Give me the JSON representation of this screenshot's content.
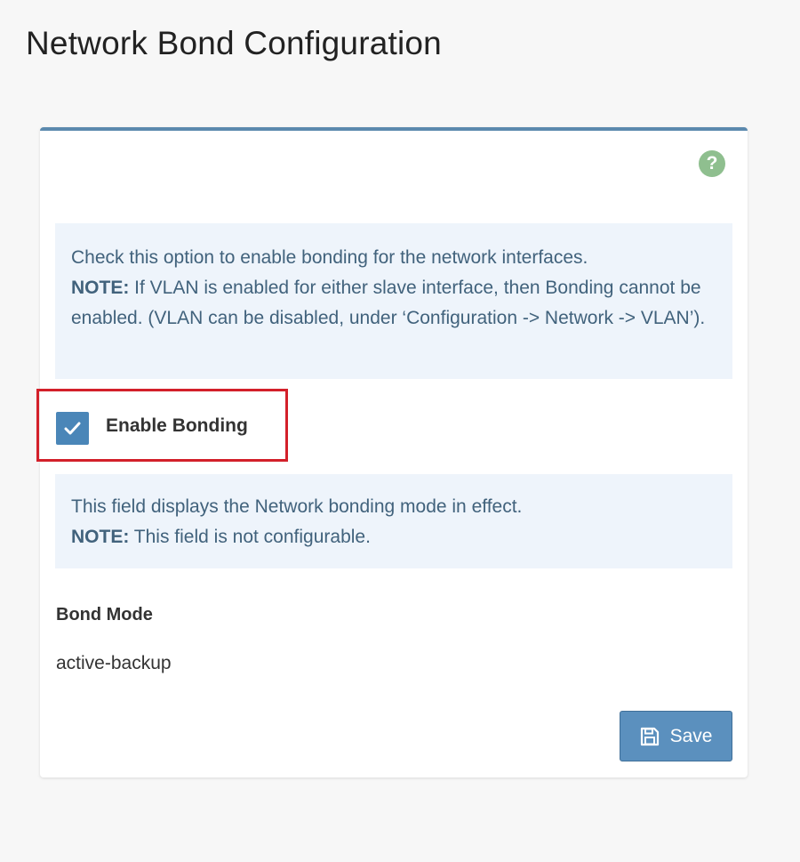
{
  "page": {
    "title": "Network Bond Configuration"
  },
  "card": {
    "help_icon": "question-circle-icon",
    "bonding_info": {
      "text": "Check this option to enable bonding for the network interfaces.",
      "note_label": "NOTE:",
      "note_text": " If VLAN is enabled for either slave interface, then Bonding cannot be enabled. (VLAN can be disabled, under ‘Configuration -> Network -> VLAN’)."
    },
    "enable_bonding": {
      "label": "Enable Bonding",
      "checked": true,
      "icon": "checkmark-icon"
    },
    "mode_info": {
      "text": "This field displays the Network bonding mode in effect.",
      "note_label": "NOTE:",
      "note_text": " This field is not configurable."
    },
    "bond_mode": {
      "label": "Bond Mode",
      "value": "active-backup"
    },
    "save": {
      "label": "Save",
      "icon": "save-icon"
    }
  },
  "colors": {
    "accent": "#5b89ae",
    "info_bg": "#eef4fb",
    "info_text": "#41627c",
    "highlight": "#d3202a",
    "help_icon": "#8fbf8f"
  }
}
